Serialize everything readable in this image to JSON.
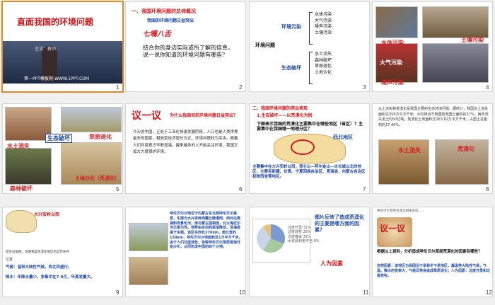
{
  "slides": [
    {
      "num": "1",
      "title": "直面我国的环境问题",
      "speaker": "主讲：教师",
      "footer": "第一PPT模板网-WWW.1PPT.COM"
    },
    {
      "num": "2",
      "heading": "一、我国环境问题的总体概况",
      "sub": "我国的环境问题日益突出",
      "tag": "七嘴八舌",
      "q": "结合你的身边实际或所了解的信息，说一说你知道的环境问题有哪些？"
    },
    {
      "num": "3",
      "main": "环境问题",
      "b1": "环境污染",
      "b2": "生态破坏",
      "l1": [
        "水体污染",
        "大气污染",
        "噪声污染",
        "土壤污染"
      ],
      "l2": [
        "水土流失",
        "森林破坏",
        "草原退化",
        "土地沙化"
      ]
    },
    {
      "num": "4",
      "cap": [
        "水体污染",
        "土壤污染",
        "大气污染",
        "噪声污染"
      ]
    },
    {
      "num": "5",
      "cap": [
        "水土流失",
        "生态破坏",
        "草原退化",
        "森林破坏",
        "土地沙化（荒漠化）"
      ]
    },
    {
      "num": "6",
      "title": "议一议",
      "q": "为什么我国目前环境问题日益突出？",
      "body": "今天的中国，正处于工业化快速发展阶段，人口也是人类世界最多的国家，粗放型经济增长方式，环境问题较为突出。随着人们环境意识不断增强，越来越多的人开始关注环境，我国正加大力度保护环境。"
    },
    {
      "num": "7",
      "heading": "二、我国环境问题的突出表现",
      "sub": "1.生态破坏——以荒漠化为例",
      "q": "下图表示我国的荒漠化主要集中在哪些地区（省区）？主要集中在我国哪一地理分区？",
      "region": "西北地区",
      "ans": "主要集中在大兴安岭以西，昆仑山—阿尔金山—古长城以北的地区，主要有新疆、甘肃、宁夏回族自治区、青海省、内蒙古自治区和陕西省等地区。"
    },
    {
      "num": "8",
      "body": "水土流失和荒漠化是我国主要的生态环境问题。据统计，我国水土流失面积达356万平方千米。大约相当于我国陆地国土面积的37%。每年流失泥土约50亿吨。荒漠化土地面积达263.62万平方千米，占国土总面积的27.46%。",
      "c1": "水土流失",
      "c2": "荒漠化"
    },
    {
      "num": "9",
      "h1": "大兴安岭以西",
      "items": [
        "位置",
        "气候：温带大陆性气候，西北风盛行。",
        "降水：年降水量少，多集中在7-9月，年蒸发量大。"
      ],
      "note": "结合这幅图，说明我国荒漠化地区的自然条件"
    },
    {
      "num": "10",
      "body": "呼伦贝尔沙地位于内蒙古东北部呼伦贝尔高原，东部为大兴安岭西麓丘陵漫岗，西对达赉湖和克鲁伦河，南与蒙古国相连，北以海拉尔河北岸为界。地势由东向西逐渐降低，且海拔高于东部。该区东西长270km，南北宽约150km，呼伦贝尔沙地面积近1万平方千米，由于人们过度放牧，导致呼伦贝尔草原逐渐开始沙化，从而形成中国的四个沙地。"
    },
    {
      "num": "11",
      "q": "图片反映了造成荒漠化的主要是哪方面的因素？",
      "a": "人为因素",
      "legend": [
        "过度开垦 31%",
        "过度放牧 28%",
        "过度樵采 32%",
        "水资源利用不当 9%"
      ]
    },
    {
      "num": "12",
      "title": "议一议",
      "q": "根据以上资料，分析造成呼伦贝尔草原荒漠化的因素有哪些？",
      "ans": "自然因素：该地区为我国沿于旱和半干旱地区，属温带大陆性气候，气温、降水的变率大，气候异常会造成草原退化；人为因素：过度开垦和过度放牧。",
      "top": "呼伦贝尔草原荒漠化相关资料……"
    }
  ],
  "colors": {
    "accent": "#d4161b",
    "blue": "#1f4aa8",
    "select": "#e08a1e"
  }
}
